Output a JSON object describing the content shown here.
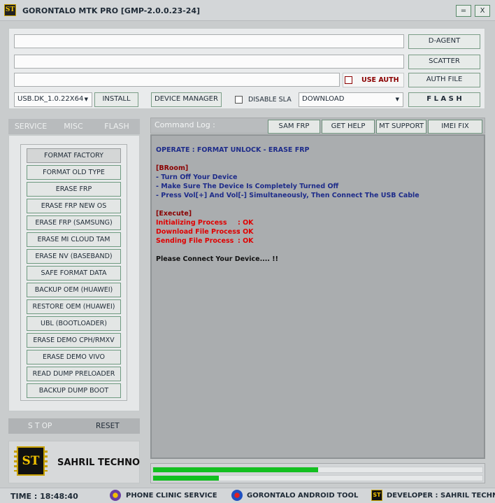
{
  "window": {
    "logo_text": "ST",
    "title": "GORONTALO MTK PRO  [GMP-2.0.0.23-24]",
    "minimize_label": "=",
    "close_label": "X"
  },
  "top": {
    "d_agent": "D-AGENT",
    "scatter": "SCATTER",
    "use_auth": "USE AUTH",
    "auth_file": "AUTH FILE",
    "driver_select": "USB.DK_1.0.22X64",
    "install": "INSTALL",
    "device_manager": "DEVICE MANAGER",
    "disable_sla": "DISABLE SLA",
    "mode_select": "DOWNLOAD",
    "flash": "F L A S H"
  },
  "tabs": [
    "SERVICE",
    "MISC",
    "FLASH"
  ],
  "functions": [
    "FORMAT FACTORY",
    "FORMAT OLD TYPE",
    "ERASE FRP",
    "ERASE FRP NEW OS",
    "ERASE FRP (SAMSUNG)",
    "ERASE MI CLOUD TAM",
    "ERASE NV (BASEBAND)",
    "SAFE FORMAT DATA",
    "BACKUP OEM (HUAWEI)",
    "RESTORE OEM (HUAWEI)",
    "UBL (BOOTLOADER)",
    "ERASE DEMO CPH/RMXV",
    "ERASE DEMO VIVO",
    "READ DUMP PRELOADER",
    "BACKUP DUMP BOOT"
  ],
  "controls": {
    "stop": "S T OP",
    "reset": "RESET"
  },
  "brand": {
    "chip_text": "ST",
    "name": "SAHRIL TECHNO"
  },
  "log": {
    "header": "Command Log :",
    "buttons": [
      "SAM FRP",
      "GET HELP",
      "MT SUPPORT",
      "IMEI FIX"
    ],
    "operate": "OPERATE  :  FORMAT UNLOCK - ERASE FRP",
    "broom_title": "[BRoom]",
    "broom_lines": [
      "- Turn Off Your Device",
      "- Make Sure The Device Is Completely Turned Off",
      "- Press Vol[+] And Vol[-] Simultaneously, Then Connect The USB Cable"
    ],
    "execute_title": "[Execute]",
    "execute_lines": [
      {
        "label": "Initializing Process",
        "status": ":  OK"
      },
      {
        "label": "Download File Process",
        "status": ":  OK"
      },
      {
        "label": "Sending File Process",
        "status": ":  OK"
      }
    ],
    "final": "Please Connect Your Device.... !!"
  },
  "progress": {
    "primary": 0.5,
    "secondary": 0.2,
    "color": "#13c020"
  },
  "status": {
    "time": "TIME :  18:48:40",
    "item1": "PHONE CLINIC SERVICE",
    "item2": "GORONTALO ANDROID TOOL",
    "item3": "DEVELOPER  :  SAHRIL TECHNO"
  },
  "colors": {
    "log_blue": "#1e2c8a",
    "log_red": "#e00000",
    "log_darkred": "#8a0000"
  }
}
